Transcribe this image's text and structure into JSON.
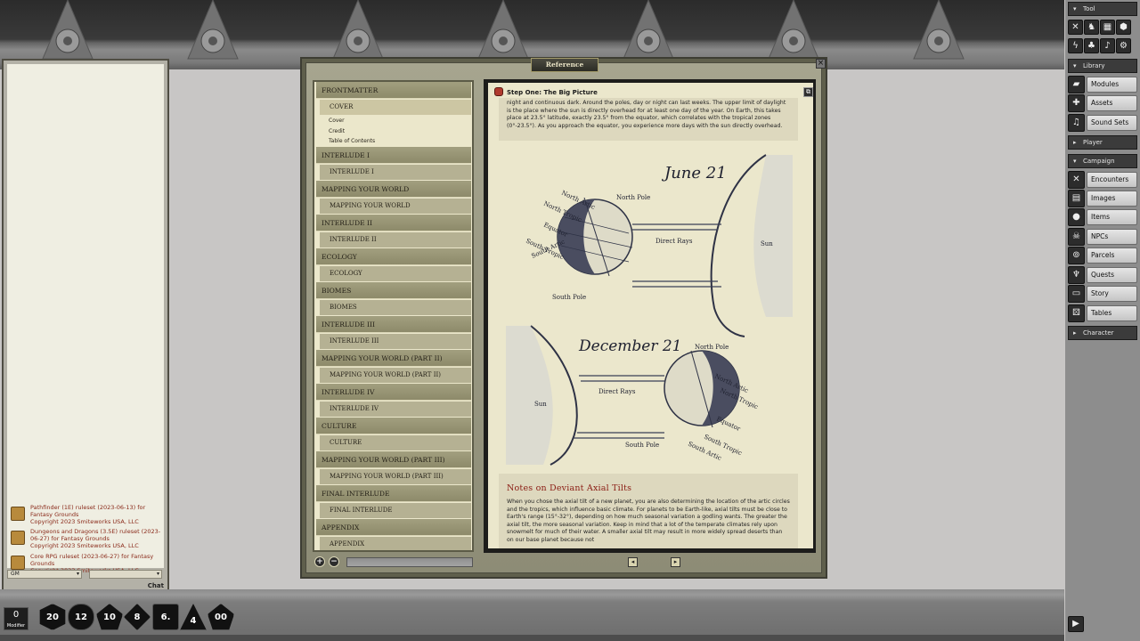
{
  "chat": {
    "messages": [
      {
        "line": "Pathfinder (1E) ruleset (2023-06-13) for Fantasy Grounds",
        "copy": "Copyright 2023 Smiteworks USA, LLC"
      },
      {
        "line": "Dungeons and Dragons (3.5E) ruleset (2023-06-27) for Fantasy Grounds",
        "copy": "Copyright 2023 Smiteworks USA, LLC"
      },
      {
        "line": "Core RPG ruleset (2023-06-27) for Fantasy Grounds",
        "copy": "Copyright 2023 Smiteworks USA, LLC"
      }
    ],
    "identity": "GM",
    "mode": "",
    "chat_button": "Chat"
  },
  "reference": {
    "title": "Reference",
    "toc": [
      {
        "heading": "FRONTMATTER",
        "subs": [
          {
            "label": "COVER",
            "active": true,
            "leaves": [
              "Cover",
              "Credit",
              "Table of Contents"
            ]
          }
        ]
      },
      {
        "heading": "INTERLUDE I",
        "subs": [
          {
            "label": "INTERLUDE I"
          }
        ]
      },
      {
        "heading": "MAPPING YOUR WORLD",
        "subs": [
          {
            "label": "MAPPING YOUR WORLD"
          }
        ]
      },
      {
        "heading": "INTERLUDE II",
        "subs": [
          {
            "label": "INTERLUDE II"
          }
        ]
      },
      {
        "heading": "ECOLOGY",
        "subs": [
          {
            "label": "ECOLOGY"
          }
        ]
      },
      {
        "heading": "BIOMES",
        "subs": [
          {
            "label": "BIOMES"
          }
        ]
      },
      {
        "heading": "INTERLUDE III",
        "subs": [
          {
            "label": "INTERLUDE III"
          }
        ]
      },
      {
        "heading": "MAPPING YOUR WORLD (PART II)",
        "subs": [
          {
            "label": "MAPPING YOUR WORLD (PART II)"
          }
        ]
      },
      {
        "heading": "INTERLUDE IV",
        "subs": [
          {
            "label": "INTERLUDE IV"
          }
        ]
      },
      {
        "heading": "CULTURE",
        "subs": [
          {
            "label": "CULTURE"
          }
        ]
      },
      {
        "heading": "MAPPING YOUR WORLD (PART III)",
        "subs": [
          {
            "label": "MAPPING YOUR WORLD (PART III)"
          }
        ]
      },
      {
        "heading": "FINAL INTERLUDE",
        "subs": [
          {
            "label": "FINAL INTERLUDE"
          }
        ]
      },
      {
        "heading": "APPENDIX",
        "subs": [
          {
            "label": "APPENDIX"
          }
        ]
      }
    ],
    "page": {
      "title": "Step One: The Big Picture",
      "intro": "night and continuous dark. Around the poles, day or night can last weeks. The upper limit of daylight is the place where the sun is directly overhead for at least one day of the year. On Earth, this takes place at 23.5° latitude, exactly 23.5° from the equator, which correlates with the tropical zones (0°-23.5°). As you approach the equator, you experience more days with the sun directly overhead.",
      "diagram": {
        "june": "June 21",
        "december": "December 21",
        "north_artic": "North Artic",
        "north_tropic": "North Tropic",
        "north_pole": "North Pole",
        "equator": "Equator",
        "south_tropic": "South Tropic",
        "south_artic": "South Artic",
        "south_pole": "South Pole",
        "direct_rays": "Direct Rays",
        "sun": "Sun"
      },
      "notes_heading": "Notes on Deviant Axial Tilts",
      "notes_text": "When you chose the axial tilt of a new planet, you are also determining the location of the artic circles and the tropics, which influence basic climate. For planets to be Earth-like, axial tilts must be close to Earth's range (15°-32°), depending on how much seasonal variation a godling wants. The greater the axial tilt, the more seasonal variation. Keep in mind that a lot of the temperate climates rely upon snowmelt for much of their water. A smaller axial tilt may result in more widely spread deserts than on our base planet because not"
    }
  },
  "sidebar": {
    "tool_header": "Tool",
    "library_header": "Library",
    "library_items": [
      "Modules",
      "Assets",
      "Sound Sets"
    ],
    "player_header": "Player",
    "campaign_header": "Campaign",
    "campaign_items": [
      "Encounters",
      "Images",
      "Items",
      "NPCs",
      "Parcels",
      "Quests",
      "Story",
      "Tables"
    ],
    "character_header": "Character"
  },
  "dice": {
    "modifier_value": "0",
    "modifier_label": "Modifier",
    "faces": [
      "20",
      "12",
      "10",
      "8",
      "6.",
      "4",
      "00"
    ]
  }
}
